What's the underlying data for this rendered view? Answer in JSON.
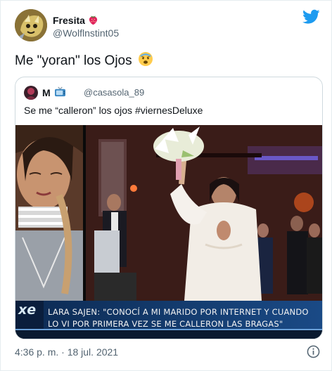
{
  "tweet": {
    "author_name": "Fresita",
    "author_emoji_icon": "strawberry-icon",
    "author_handle": "@Wolflnstint05",
    "text": "Me \"yoran\" los Ojos",
    "text_emoji_icon": "anxious-face-icon",
    "timestamp": "4:36 p. m. · 18 jul. 2021"
  },
  "quoted_tweet": {
    "author_name": "M",
    "author_emoji_icon": "television-icon",
    "author_handle": "@casasola_89",
    "text": "Se me “calleron” los ojos #viernesDeluxe",
    "media": {
      "logo": "xe",
      "caption_line_1": "LARA SAJEN: \"CONOCÍ A MI MARIDO POR INTERNET Y CUANDO",
      "caption_line_2": "LO VI POR PRIMERA VEZ SE ME CALLERON LAS BRAGAS\""
    }
  },
  "colors": {
    "twitter_blue": "#1d9bf0",
    "secondary_text": "#536471",
    "border": "#cfd9de"
  }
}
